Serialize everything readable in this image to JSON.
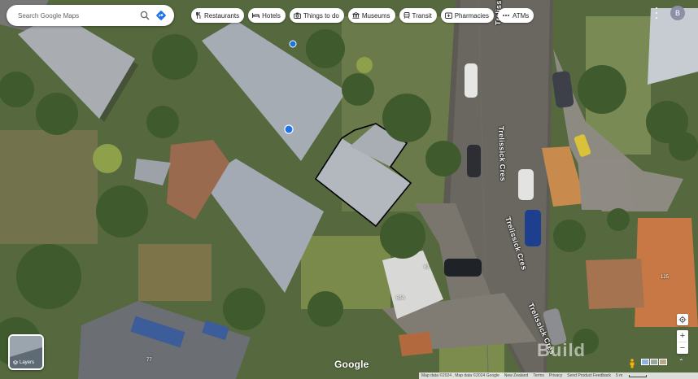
{
  "search": {
    "placeholder": "Search Google Maps"
  },
  "chips": [
    {
      "label": "Restaurants",
      "icon": "fork-knife-icon"
    },
    {
      "label": "Hotels",
      "icon": "bed-icon"
    },
    {
      "label": "Things to do",
      "icon": "camera-icon"
    },
    {
      "label": "Museums",
      "icon": "museum-icon"
    },
    {
      "label": "Transit",
      "icon": "train-icon"
    },
    {
      "label": "Pharmacies",
      "icon": "pharmacy-icon"
    },
    {
      "label": "ATMs",
      "icon": "atm-icon"
    }
  ],
  "account": {
    "initial": "B"
  },
  "layers": {
    "label": "Layers"
  },
  "map": {
    "streets": [
      "Trelissick Cres",
      "Trelissick Cres",
      "Trelissick Cres",
      "Trelissick Cres"
    ],
    "house_numbers": [
      "63",
      "63A",
      "77",
      "125"
    ],
    "google_logo": "Google",
    "watermark": "Build"
  },
  "controls": {
    "zoom_in": "+",
    "zoom_out": "−",
    "expand": "⌃"
  },
  "footer": {
    "attribution": "Map data ©2024 , Map data ©2024 Google",
    "country": "New Zealand",
    "terms": "Terms",
    "privacy": "Privacy",
    "feedback": "Send Product Feedback",
    "scale": "5 m"
  },
  "colors": {
    "highlight_outline": "#000000",
    "chip_bg": "#ffffff",
    "avatar_bg": "#8e8fa7"
  }
}
